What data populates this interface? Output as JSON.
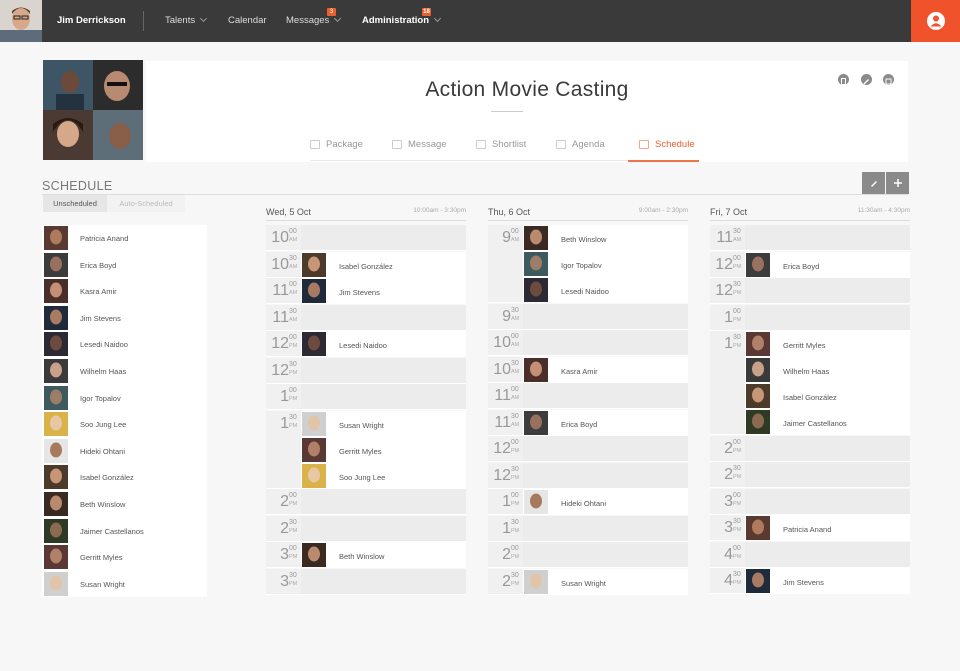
{
  "topbar": {
    "user_name": "Jim Derrickson",
    "nav": [
      {
        "label": "Talents",
        "dropdown": true,
        "bold": false
      },
      {
        "label": "Calendar",
        "dropdown": false,
        "bold": false
      },
      {
        "label": "Messages",
        "dropdown": true,
        "badge": "3",
        "bold": false
      },
      {
        "label": "Administration",
        "dropdown": true,
        "badge": "18",
        "bold": true
      }
    ],
    "user_icon": "user-circle-icon",
    "accent": "#f0522c"
  },
  "project": {
    "title": "Action Movie Casting",
    "header_icons": [
      "document-icon",
      "edit-icon",
      "archive-icon"
    ],
    "tabs": [
      {
        "label": "Package",
        "icon": "folder-icon",
        "active": false
      },
      {
        "label": "Message",
        "icon": "message-icon",
        "active": false
      },
      {
        "label": "Shortlist",
        "icon": "share-icon",
        "active": false
      },
      {
        "label": "Agenda",
        "icon": "clipboard-icon",
        "active": false
      },
      {
        "label": "Schedule",
        "icon": "calendar-icon",
        "active": true
      }
    ]
  },
  "schedule": {
    "heading": "SCHEDULE",
    "toggle": {
      "unscheduled": "Unscheduled",
      "auto": "Auto-Scheduled"
    },
    "actions": [
      "edit-icon",
      "plus-icon"
    ],
    "talents": [
      "Patricia Anand",
      "Erica Boyd",
      "Kasra Amir",
      "Jim Stevens",
      "Lesedi Naidoo",
      "Wilhelm Haas",
      "Igor Topalov",
      "Soo Jung Lee",
      "Hideki Ohtani",
      "Isabel González",
      "Beth Winslow",
      "Jaimer Castellanos",
      "Gerritt Myles",
      "Susan Wright"
    ],
    "days": [
      {
        "name": "Wed, 5 Oct",
        "range": "10:00am - 3:30pm",
        "slots": [
          {
            "h": "10",
            "m": "00",
            "ap": "AM",
            "people": []
          },
          {
            "h": "10",
            "m": "30",
            "ap": "AM",
            "people": [
              "Isabel González"
            ]
          },
          {
            "h": "11",
            "m": "00",
            "ap": "AM",
            "people": [
              "Jim Stevens"
            ]
          },
          {
            "h": "11",
            "m": "30",
            "ap": "AM",
            "people": []
          },
          {
            "h": "12",
            "m": "00",
            "ap": "PM",
            "people": [
              "Lesedi Naidoo"
            ]
          },
          {
            "h": "12",
            "m": "30",
            "ap": "PM",
            "people": []
          },
          {
            "h": "1",
            "m": "00",
            "ap": "PM",
            "people": []
          },
          {
            "h": "1",
            "m": "30",
            "ap": "PM",
            "people": [
              "Susan Wright",
              "Gerritt Myles",
              "Soo Jung Lee"
            ]
          },
          {
            "h": "2",
            "m": "00",
            "ap": "PM",
            "people": []
          },
          {
            "h": "2",
            "m": "30",
            "ap": "PM",
            "people": []
          },
          {
            "h": "3",
            "m": "00",
            "ap": "PM",
            "people": [
              "Beth Winslow"
            ]
          },
          {
            "h": "3",
            "m": "30",
            "ap": "PM",
            "people": []
          }
        ]
      },
      {
        "name": "Thu, 6 Oct",
        "range": "9:00am - 2:30pm",
        "slots": [
          {
            "h": "9",
            "m": "00",
            "ap": "AM",
            "people": [
              "Beth Winslow",
              "Igor Topalov",
              "Lesedi Naidoo"
            ]
          },
          {
            "h": "9",
            "m": "30",
            "ap": "AM",
            "people": []
          },
          {
            "h": "10",
            "m": "00",
            "ap": "AM",
            "people": []
          },
          {
            "h": "10",
            "m": "30",
            "ap": "AM",
            "people": [
              "Kasra Amir"
            ]
          },
          {
            "h": "11",
            "m": "00",
            "ap": "AM",
            "people": []
          },
          {
            "h": "11",
            "m": "30",
            "ap": "AM",
            "people": [
              "Erica Boyd"
            ]
          },
          {
            "h": "12",
            "m": "00",
            "ap": "PM",
            "people": []
          },
          {
            "h": "12",
            "m": "30",
            "ap": "PM",
            "people": []
          },
          {
            "h": "1",
            "m": "00",
            "ap": "PM",
            "people": [
              "Hideki Ohtani"
            ]
          },
          {
            "h": "1",
            "m": "30",
            "ap": "PM",
            "people": []
          },
          {
            "h": "2",
            "m": "00",
            "ap": "PM",
            "people": []
          },
          {
            "h": "2",
            "m": "30",
            "ap": "PM",
            "people": [
              "Susan Wright"
            ]
          }
        ]
      },
      {
        "name": "Fri, 7 Oct",
        "range": "11:30am - 4:30pm",
        "slots": [
          {
            "h": "11",
            "m": "30",
            "ap": "AM",
            "people": []
          },
          {
            "h": "12",
            "m": "00",
            "ap": "PM",
            "people": [
              "Erica Boyd"
            ]
          },
          {
            "h": "12",
            "m": "30",
            "ap": "PM",
            "people": []
          },
          {
            "h": "1",
            "m": "00",
            "ap": "PM",
            "people": []
          },
          {
            "h": "1",
            "m": "30",
            "ap": "PM",
            "people": [
              "Gerritt Myles",
              "Wilhelm Haas",
              "Isabel González",
              "Jaimer Castellanos"
            ]
          },
          {
            "h": "2",
            "m": "00",
            "ap": "PM",
            "people": []
          },
          {
            "h": "2",
            "m": "30",
            "ap": "PM",
            "people": []
          },
          {
            "h": "3",
            "m": "00",
            "ap": "PM",
            "people": []
          },
          {
            "h": "3",
            "m": "30",
            "ap": "PM",
            "people": [
              "Patricia Anand"
            ]
          },
          {
            "h": "4",
            "m": "00",
            "ap": "PM",
            "people": []
          },
          {
            "h": "4",
            "m": "30",
            "ap": "PM",
            "people": [
              "Jim Stevens"
            ]
          }
        ]
      }
    ]
  }
}
